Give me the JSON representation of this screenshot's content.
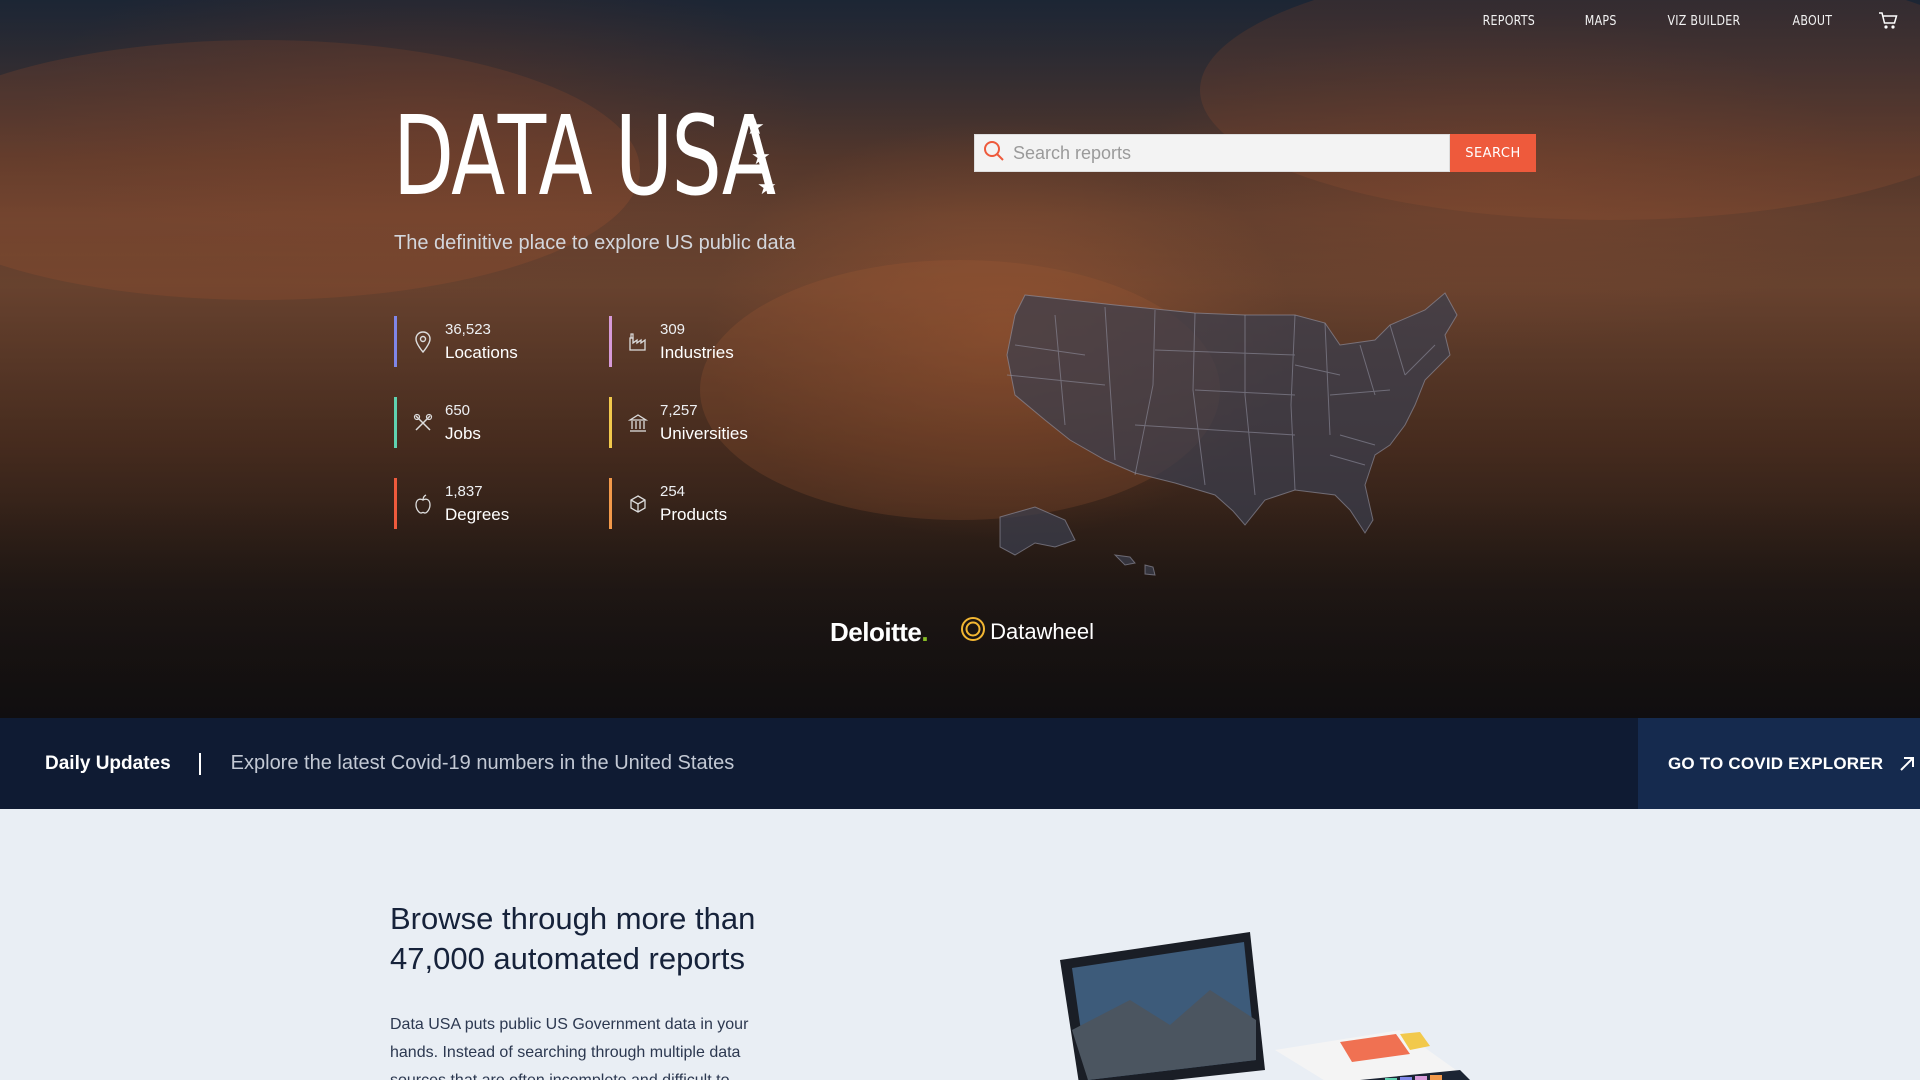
{
  "nav": {
    "items": [
      "REPORTS",
      "MAPS",
      "VIZ BUILDER",
      "ABOUT"
    ],
    "cart_icon": "cart-icon"
  },
  "brand": {
    "logo_text": "DATA USA",
    "tagline": "The definitive place to explore US public data"
  },
  "search": {
    "placeholder": "Search reports",
    "button_label": "SEARCH",
    "icon": "search-icon"
  },
  "stats": [
    {
      "number": "36,523",
      "label": "Locations",
      "icon": "location-pin-icon",
      "color": "#7f86e8"
    },
    {
      "number": "309",
      "label": "Industries",
      "icon": "factory-icon",
      "color": "#d79ad8"
    },
    {
      "number": "650",
      "label": "Jobs",
      "icon": "tools-icon",
      "color": "#5fd2b0"
    },
    {
      "number": "7,257",
      "label": "Universities",
      "icon": "university-icon",
      "color": "#f2c94c"
    },
    {
      "number": "1,837",
      "label": "Degrees",
      "icon": "apple-icon",
      "color": "#ee5a3c"
    },
    {
      "number": "254",
      "label": "Products",
      "icon": "package-icon",
      "color": "#f2994a"
    }
  ],
  "partners": {
    "deloitte": "Deloitte",
    "datawheel": "Datawheel"
  },
  "covid": {
    "title": "Daily Updates",
    "text": "Explore the latest Covid-19 numbers in the United States",
    "button_label": "GO TO COVID EXPLORER"
  },
  "browse": {
    "heading": "Browse through more than 47,000 automated reports",
    "body": "Data USA puts public US Government data in your hands. Instead of searching through multiple data sources that are often incomplete and difficult to"
  },
  "colors": {
    "accent": "#ee5a3c",
    "covid_bar": "#0f1b33",
    "covid_button": "#152a4e"
  }
}
